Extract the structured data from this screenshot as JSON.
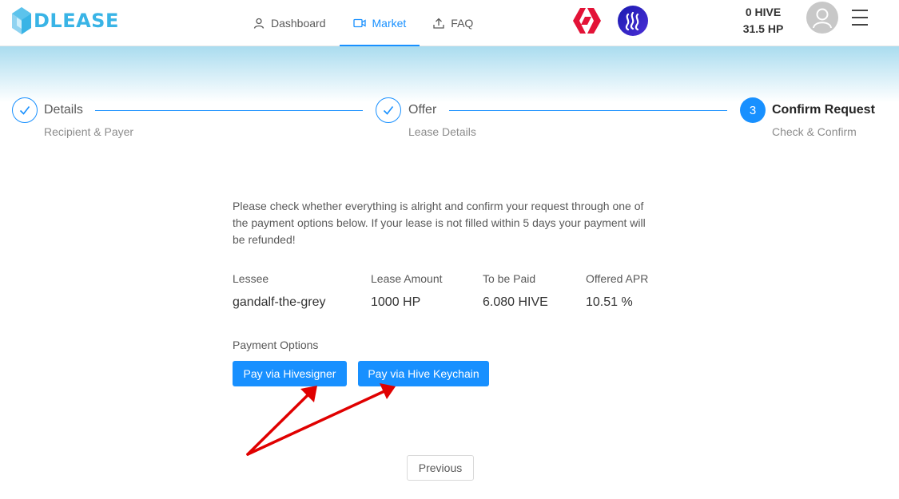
{
  "header": {
    "logo_text": "DLEASE",
    "nav": [
      {
        "label": "Dashboard",
        "icon": "user-icon"
      },
      {
        "label": "Market",
        "icon": "video-icon",
        "active": true
      },
      {
        "label": "FAQ",
        "icon": "upload-icon"
      }
    ],
    "balance_hive": "0 HIVE",
    "balance_hp": "31.5 HP"
  },
  "steps": [
    {
      "title": "Details",
      "description": "Recipient & Payer",
      "status": "done"
    },
    {
      "title": "Offer",
      "description": "Lease Details",
      "status": "done"
    },
    {
      "number": "3",
      "title": "Confirm Request",
      "description": "Check & Confirm",
      "status": "current"
    }
  ],
  "intro_text": "Please check whether everything is alright and confirm your request through one of the payment options below. If your lease is not filled within 5 days your payment will be refunded!",
  "summary": [
    {
      "label": "Lessee",
      "value": "gandalf-the-grey"
    },
    {
      "label": "Lease Amount",
      "value": "1000 HP"
    },
    {
      "label": "To be Paid",
      "value": "6.080 HIVE"
    },
    {
      "label": "Offered APR",
      "value": "10.51 %"
    }
  ],
  "payment": {
    "label": "Payment Options",
    "hivesigner_button": "Pay via Hivesigner",
    "keychain_button": "Pay via Hive Keychain"
  },
  "previous_button": "Previous",
  "colors": {
    "primary": "#1890ff",
    "logo": "#39b4e6",
    "hive_red": "#e31337",
    "annotation_arrow": "#e00000"
  }
}
